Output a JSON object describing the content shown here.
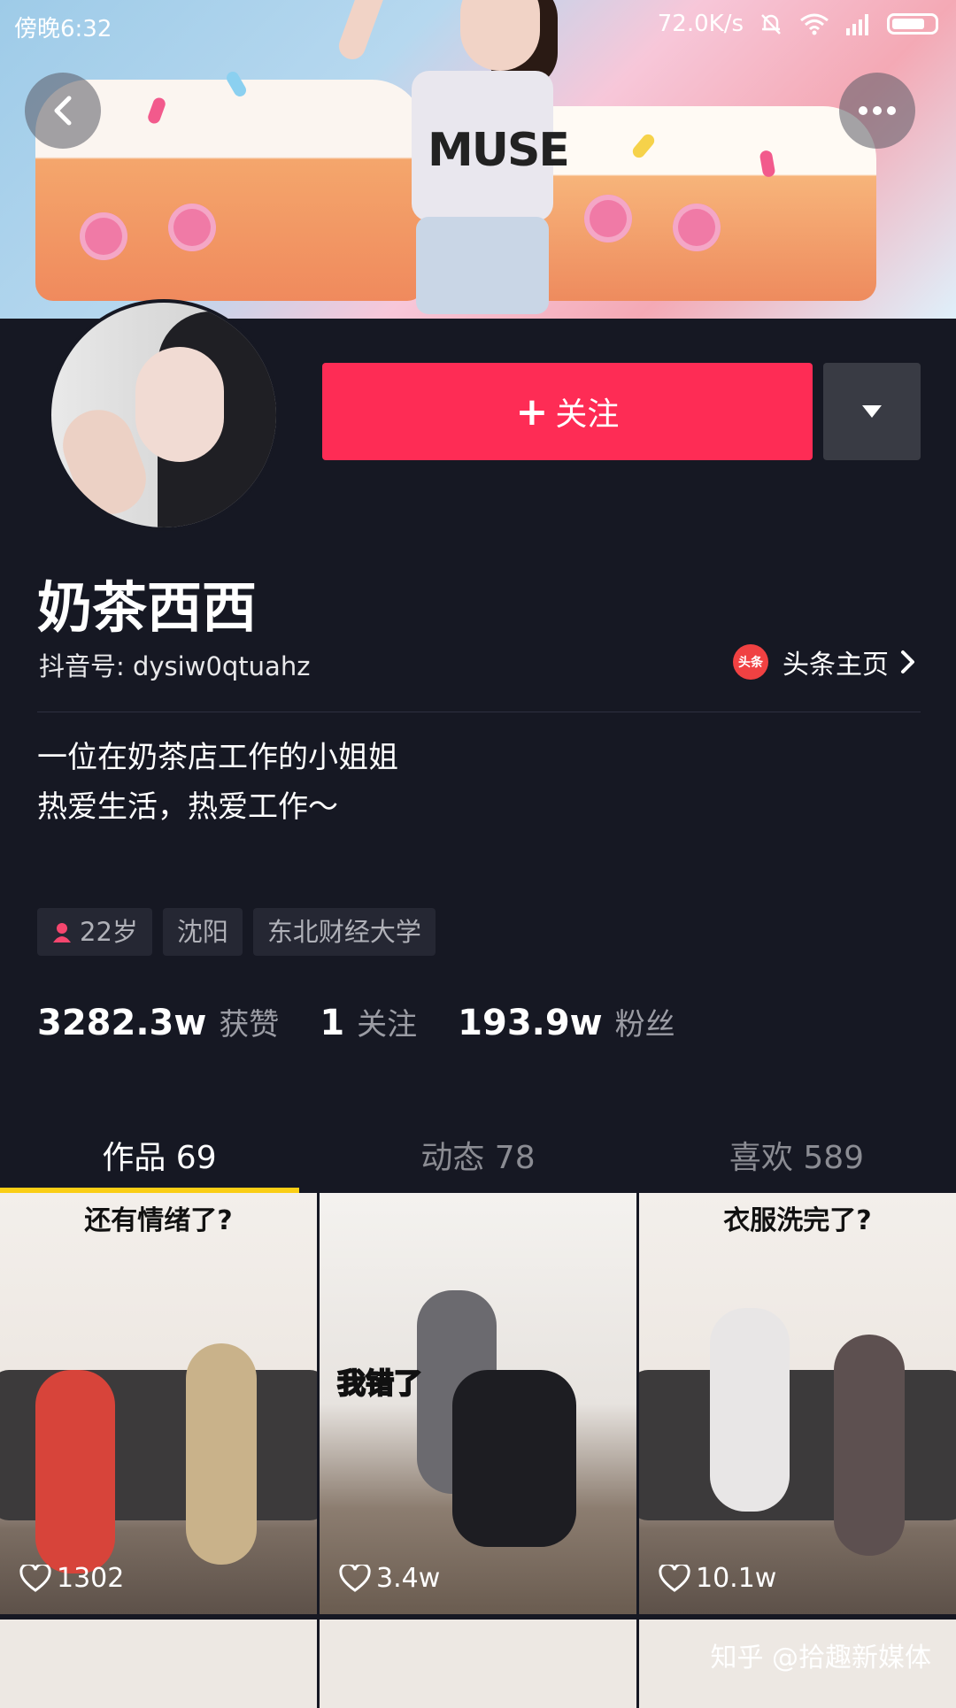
{
  "status_bar": {
    "time": "傍晚6:32",
    "network_speed": "72.0K/s",
    "icons": [
      "mute-bell-icon",
      "wifi-icon",
      "signal-icon",
      "battery-icon"
    ]
  },
  "profile": {
    "nickname": "奶茶西西",
    "douyin_id": "抖音号: dysiw0qtuahz",
    "toutiao_link": "头条主页",
    "toutiao_logo_text": "头条",
    "bio_line1": "一位在奶茶店工作的小姐姐",
    "bio_line2": "热爱生活，热爱工作～",
    "tags": {
      "age": "22岁",
      "city": "沈阳",
      "school": "东北财经大学"
    }
  },
  "actions": {
    "follow_label": "关注",
    "follow_plus": "+"
  },
  "stats": {
    "likes_value": "3282.3w",
    "likes_label": "获赞",
    "following_value": "1",
    "following_label": "关注",
    "followers_value": "193.9w",
    "followers_label": "粉丝"
  },
  "tabs": [
    {
      "label": "作品 69",
      "active": true
    },
    {
      "label": "动态 78",
      "active": false
    },
    {
      "label": "喜欢 589",
      "active": false
    }
  ],
  "videos": [
    {
      "caption": "还有情绪了?",
      "sticker": "",
      "likes": "1302"
    },
    {
      "caption": "",
      "sticker": "我错了",
      "likes": "3.4w"
    },
    {
      "caption": "衣服洗完了?",
      "sticker": "",
      "likes": "10.1w"
    }
  ],
  "watermark": "知乎 @拾趣新媒体",
  "colors": {
    "background": "#161823",
    "follow_button": "#fe2c55",
    "tab_indicator": "#face15"
  }
}
